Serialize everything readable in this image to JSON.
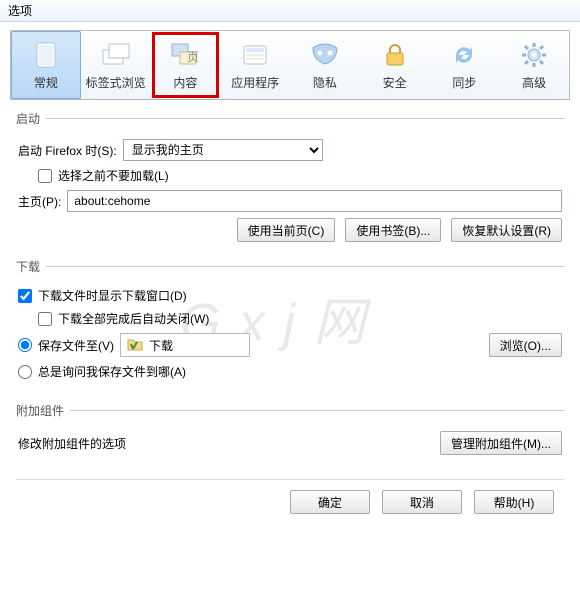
{
  "window": {
    "title": "选项"
  },
  "toolbar": {
    "items": [
      {
        "label": "常规"
      },
      {
        "label": "标签式浏览"
      },
      {
        "label": "内容"
      },
      {
        "label": "应用程序"
      },
      {
        "label": "隐私"
      },
      {
        "label": "安全"
      },
      {
        "label": "同步"
      },
      {
        "label": "高级"
      }
    ]
  },
  "startup": {
    "legend": "启动",
    "onstart_label": "启动 Firefox 时(S):",
    "onstart_value": "显示我的主页",
    "noload_label": "选择之前不要加载(L)",
    "homepage_label": "主页(P):",
    "homepage_value": "about:cehome",
    "btn_current": "使用当前页(C)",
    "btn_bookmark": "使用书签(B)...",
    "btn_restore": "恢复默认设置(R)"
  },
  "download": {
    "legend": "下载",
    "show_dlg_label": "下载文件时显示下载窗口(D)",
    "autoclose_label": "下载全部完成后自动关闭(W)",
    "saveto_label": "保存文件至(V)",
    "saveto_folder": "下载",
    "browse_btn": "浏览(O)...",
    "ask_label": "总是询问我保存文件到哪(A)"
  },
  "addons": {
    "legend": "附加组件",
    "desc": "修改附加组件的选项",
    "manage_btn": "管理附加组件(M)..."
  },
  "footer": {
    "ok": "确定",
    "cancel": "取消",
    "help": "帮助(H)"
  },
  "watermark": "G x j 网"
}
